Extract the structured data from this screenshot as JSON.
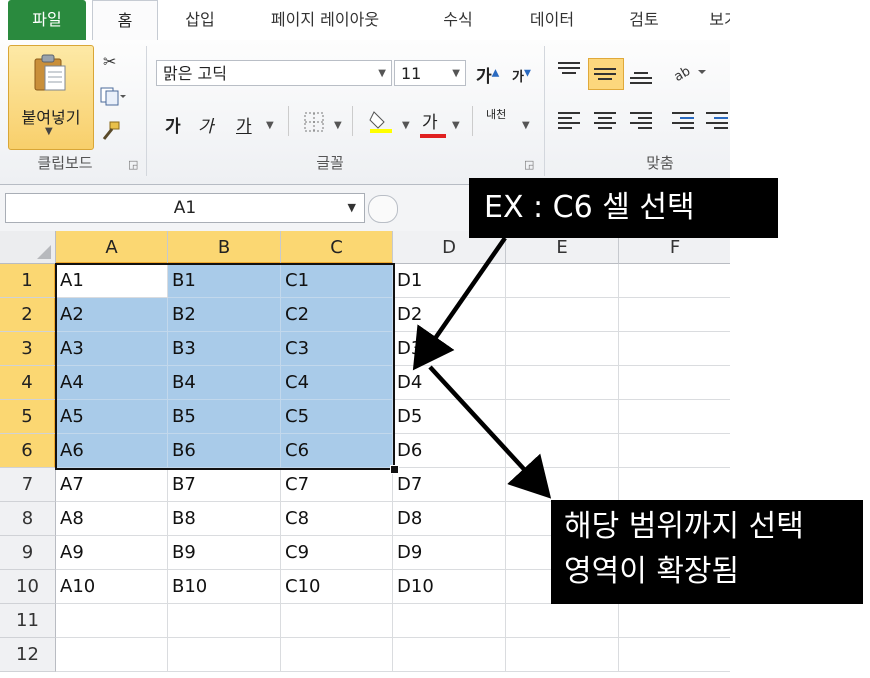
{
  "ribbon": {
    "tabs": [
      {
        "label": "파일",
        "state": "file"
      },
      {
        "label": "홈",
        "state": "active"
      },
      {
        "label": "삽입",
        "state": ""
      },
      {
        "label": "페이지 레이아웃",
        "state": ""
      },
      {
        "label": "수식",
        "state": ""
      },
      {
        "label": "데이터",
        "state": ""
      },
      {
        "label": "검토",
        "state": ""
      },
      {
        "label": "보기",
        "state": ""
      }
    ],
    "clipboard": {
      "paste_label": "붙여넣기",
      "group_label": "클립보드"
    },
    "font": {
      "name": "맑은 고딕",
      "size": "11",
      "group_label": "글꼴",
      "grow_label": "가",
      "shrink_label": "가",
      "bold_label": "가",
      "italic_label": "가",
      "underline_label": "가",
      "color_label": "가",
      "phonetic_label": "내천"
    },
    "alignment": {
      "group_label": "맞춤"
    },
    "colors": {
      "accent": "#2a8a3e",
      "highlight": "#fcd77d",
      "selection": "#a9cbe9",
      "header_selected": "#fbd772"
    }
  },
  "formula_bar": {
    "name_box": "A1"
  },
  "grid": {
    "columns": [
      "A",
      "B",
      "C",
      "D",
      "E",
      "F"
    ],
    "selected_columns": [
      "A",
      "B",
      "C"
    ],
    "rows": [
      "1",
      "2",
      "3",
      "4",
      "5",
      "6",
      "7",
      "8",
      "9",
      "10",
      "11",
      "12"
    ],
    "selected_rows": [
      "1",
      "2",
      "3",
      "4",
      "5",
      "6"
    ],
    "cells": [
      [
        "A1",
        "B1",
        "C1",
        "D1",
        "",
        ""
      ],
      [
        "A2",
        "B2",
        "C2",
        "D2",
        "",
        ""
      ],
      [
        "A3",
        "B3",
        "C3",
        "D3",
        "",
        ""
      ],
      [
        "A4",
        "B4",
        "C4",
        "D4",
        "",
        ""
      ],
      [
        "A5",
        "B5",
        "C5",
        "D5",
        "",
        ""
      ],
      [
        "A6",
        "B6",
        "C6",
        "D6",
        "",
        ""
      ],
      [
        "A7",
        "B7",
        "C7",
        "D7",
        "",
        ""
      ],
      [
        "A8",
        "B8",
        "C8",
        "D8",
        "",
        ""
      ],
      [
        "A9",
        "B9",
        "C9",
        "D9",
        "",
        ""
      ],
      [
        "A10",
        "B10",
        "C10",
        "D10",
        "",
        ""
      ],
      [
        "",
        "",
        "",
        "",
        "",
        ""
      ],
      [
        "",
        "",
        "",
        "",
        "",
        ""
      ]
    ]
  },
  "annotations": {
    "callout1": "EX : C6 셀 선택",
    "callout2_line1": "해당 범위까지 선택",
    "callout2_line2": "영역이 확장됨"
  }
}
